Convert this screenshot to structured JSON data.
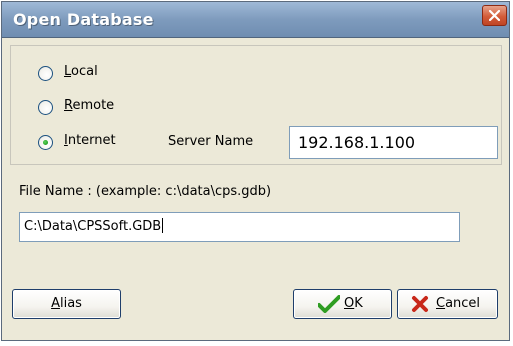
{
  "window": {
    "title": "Open Database"
  },
  "location_group": {
    "options": [
      {
        "label": "Local",
        "selected": false
      },
      {
        "label": "Remote",
        "selected": false
      },
      {
        "label": "Internet",
        "selected": true
      }
    ],
    "server_name_label": "Server Name",
    "server_name_value": "192.168.1.100"
  },
  "file": {
    "label": "File Name :  (example: c:\\data\\cps.gdb)",
    "value": "C:\\Data\\CPSSoft.GDB"
  },
  "buttons": {
    "alias": "Alias",
    "ok": "OK",
    "cancel": "Cancel"
  },
  "icons": {
    "close": "close-icon",
    "ok": "checkmark-icon",
    "cancel": "x-icon"
  },
  "colors": {
    "titlebar": "#7e9bbd",
    "dialog_bg": "#ece9d8",
    "radio_selected": "#21a121",
    "close_button": "#d35c39"
  }
}
